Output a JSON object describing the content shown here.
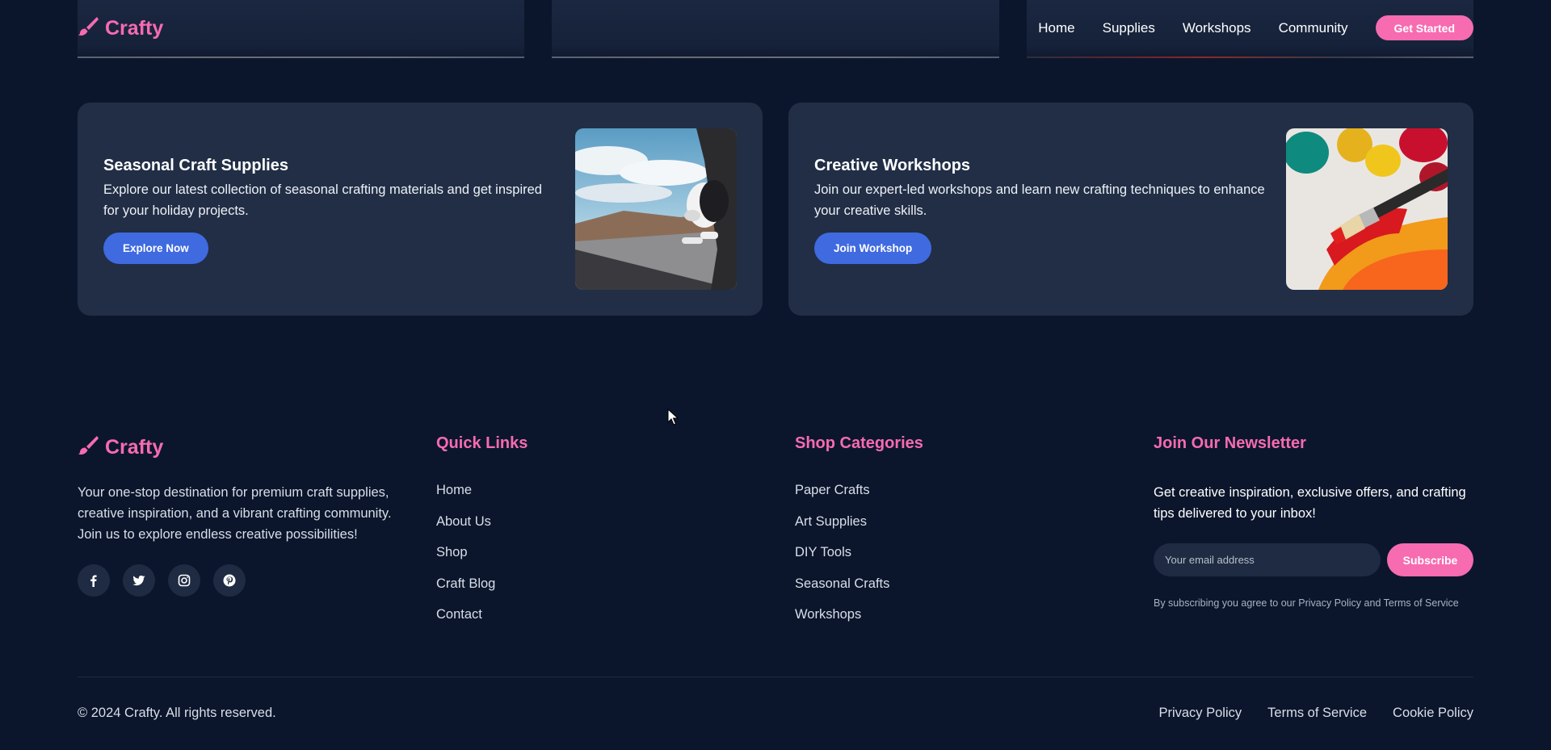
{
  "brand": {
    "name": "Crafty",
    "accent": "#f76bb1",
    "icon": "paintbrush-icon"
  },
  "nav": {
    "links": [
      "Home",
      "Supplies",
      "Workshops",
      "Community"
    ],
    "cta": "Get Started"
  },
  "features": [
    {
      "title": "Seasonal Craft Supplies",
      "description": "Explore our latest collection of seasonal crafting materials and get inspired for your holiday projects.",
      "button": "Explore Now",
      "image": "dog-in-car-window-photo"
    },
    {
      "title": "Creative Workshops",
      "description": "Join our expert-led workshops and learn new crafting techniques to enhance your creative skills.",
      "button": "Join Workshop",
      "image": "paint-brush-with-paints-photo"
    }
  ],
  "footer": {
    "description": "Your one-stop destination for premium craft supplies, creative inspiration, and a vibrant crafting community. Join us to explore endless creative possibilities!",
    "socials": [
      "facebook-icon",
      "twitter-icon",
      "instagram-icon",
      "pinterest-icon"
    ],
    "quick_links": {
      "title": "Quick Links",
      "items": [
        "Home",
        "About Us",
        "Shop",
        "Craft Blog",
        "Contact"
      ]
    },
    "shop_categories": {
      "title": "Shop Categories",
      "items": [
        "Paper Crafts",
        "Art Supplies",
        "DIY Tools",
        "Seasonal Crafts",
        "Workshops"
      ]
    },
    "newsletter": {
      "title": "Join Our Newsletter",
      "description": "Get creative inspiration, exclusive offers, and crafting tips delivered to your inbox!",
      "placeholder": "Your email address",
      "button": "Subscribe",
      "note": "By subscribing you agree to our Privacy Policy and Terms of Service"
    },
    "copyright": "© 2024 Crafty. All rights reserved.",
    "legal": [
      "Privacy Policy",
      "Terms of Service",
      "Cookie Policy"
    ]
  },
  "colors": {
    "background": "#0b162c",
    "card": "#212e46",
    "blue_button": "#3f6ae0",
    "pink": "#f76bb1"
  }
}
